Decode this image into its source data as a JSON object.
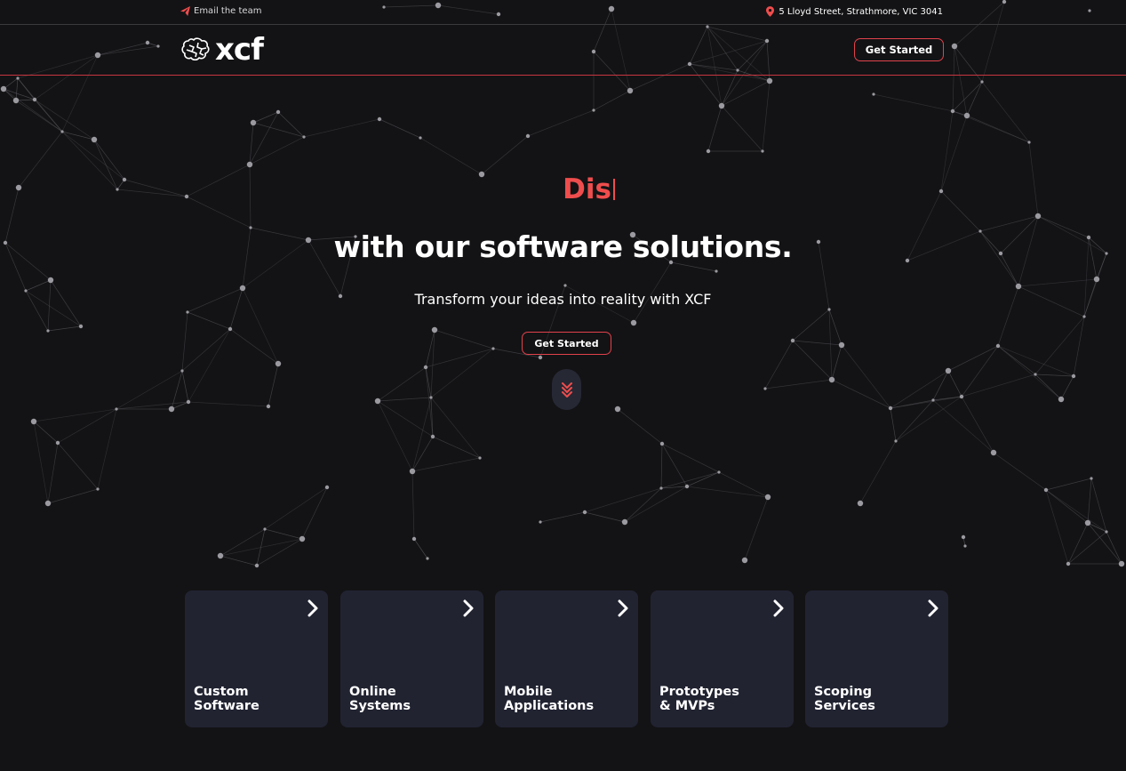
{
  "topbar": {
    "email_label": "Email the team",
    "address": "5 Lloyd Street, Strathmore, VIC 3041"
  },
  "header": {
    "logo_text": "xcf",
    "cta_label": "Get Started"
  },
  "hero": {
    "typed_text": "Dis",
    "title": "with our software solutions.",
    "subtitle": "Transform your ideas into reality with XCF",
    "cta_label": "Get Started"
  },
  "services": [
    {
      "line1": "Custom",
      "line2": "Software"
    },
    {
      "line1": "Online",
      "line2": "Systems"
    },
    {
      "line1": "Mobile",
      "line2": "Applications"
    },
    {
      "line1": "Prototypes",
      "line2": "& MVPs"
    },
    {
      "line1": "Scoping",
      "line2": "Services"
    }
  ],
  "colors": {
    "background": "#131315",
    "accent": "#ef4d4d",
    "card": "#212331",
    "network_line": "#5a5a60",
    "network_node": "#9a9aa0"
  },
  "icons": {
    "email": "paper-plane-icon",
    "address": "map-pin-icon",
    "scroll": "double-chevron-down-icon",
    "card": "chevron-right-icon"
  }
}
